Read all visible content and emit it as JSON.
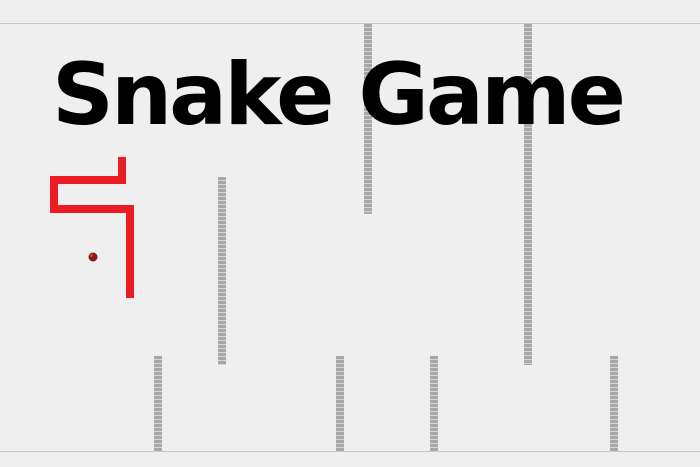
{
  "title": "Snake Game",
  "colors": {
    "background": "#efefef",
    "snake": "#ec1c24",
    "food": "#8b1a1a",
    "wall": "#a8a8a8",
    "title": "#000000"
  },
  "game": {
    "snake_color": "red",
    "food_icon": "apple-dot",
    "wall_style": "striped-gray"
  }
}
